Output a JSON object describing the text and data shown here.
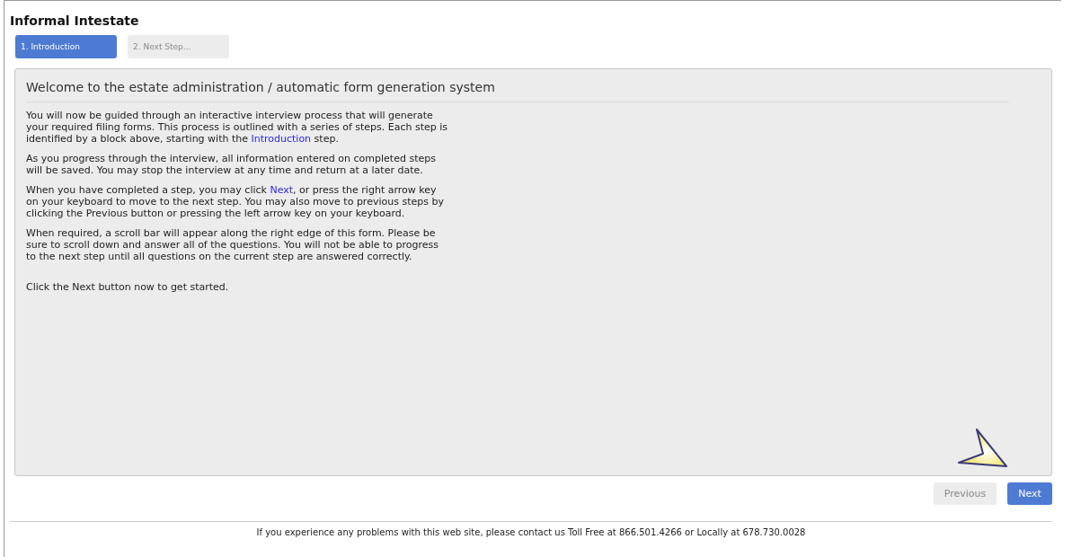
{
  "page_title": "Informal Intestate",
  "steps": [
    {
      "label": "1. Introduction",
      "selected": true
    },
    {
      "label": "2. Next Step...",
      "selected": false
    }
  ],
  "panel": {
    "heading": "Welcome to the estate administration / automatic form generation system",
    "paragraphs": [
      [
        {
          "kind": "text",
          "text": "You will now be guided through an interactive interview process that will generate your required filing forms. This process is outlined with a series of steps. Each step is identified by a block above, starting with the "
        },
        {
          "kind": "link",
          "text": "Introduction"
        },
        {
          "kind": "text",
          "text": " step."
        }
      ],
      [
        {
          "kind": "text",
          "text": "As you progress through the interview, all information entered on completed steps will be saved. You may stop the interview at any time and return at a later date."
        }
      ],
      [
        {
          "kind": "text",
          "text": "When you have completed a step, you may click "
        },
        {
          "kind": "link",
          "text": "Next"
        },
        {
          "kind": "text",
          "text": ", or press the right arrow key on your keyboard to move to the next step. You may also move to previous steps by clicking the Previous button or pressing the left arrow key on your keyboard."
        }
      ],
      [
        {
          "kind": "text",
          "text": "When required, a scroll bar will appear along the right edge of this form. Please be sure to scroll down and answer all of the questions. You will not be able to progress to the next step until all questions on the current step are answered correctly."
        }
      ],
      [
        {
          "kind": "spacer"
        }
      ],
      [
        {
          "kind": "text",
          "text": "Click the Next button now to get started."
        }
      ]
    ]
  },
  "buttons": [
    {
      "label": "Previous",
      "disabled": true
    },
    {
      "label": "Next",
      "disabled": false
    }
  ],
  "footer": "If you experience any problems with this web site, please contact us Toll Free at 866.501.4266 or Locally at 678.730.0028"
}
